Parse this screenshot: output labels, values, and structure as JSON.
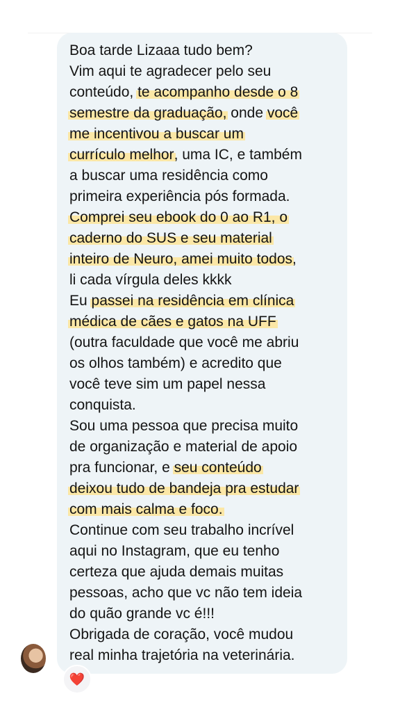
{
  "message": {
    "lines": [
      [
        {
          "t": "Boa tarde Lizaaa tudo bem?",
          "h": false
        }
      ],
      [
        {
          "t": "Vim aqui te agradecer pelo seu",
          "h": false
        }
      ],
      [
        {
          "t": "conteúdo, ",
          "h": false
        },
        {
          "t": "te acompanho desde o 8",
          "h": true
        }
      ],
      [
        {
          "t": "semestre da graduação,",
          "h": true
        },
        {
          "t": " onde ",
          "h": false
        },
        {
          "t": "você",
          "h": true
        }
      ],
      [
        {
          "t": "me incentivou a buscar um",
          "h": true
        }
      ],
      [
        {
          "t": "currículo melhor",
          "h": true
        },
        {
          "t": ", uma IC, e também",
          "h": false
        }
      ],
      [
        {
          "t": "a buscar uma residência como",
          "h": false
        }
      ],
      [
        {
          "t": "primeira experiência pós formada.",
          "h": false
        }
      ],
      [
        {
          "t": "Comprei seu ebook do 0 ao R1, o",
          "h": true
        }
      ],
      [
        {
          "t": "caderno do SUS e seu material",
          "h": true
        }
      ],
      [
        {
          "t": "inteiro de Neuro, amei muito todos",
          "h": true
        },
        {
          "t": ",",
          "h": false
        }
      ],
      [
        {
          "t": "li cada vírgula deles kkkk",
          "h": false
        }
      ],
      [
        {
          "t": "Eu ",
          "h": false
        },
        {
          "t": "passei na residência em clínica",
          "h": true
        }
      ],
      [
        {
          "t": "médica de cães e gatos na UFF",
          "h": true
        }
      ],
      [
        {
          "t": "(outra faculdade que você me abriu",
          "h": false
        }
      ],
      [
        {
          "t": "os olhos também) e acredito que",
          "h": false
        }
      ],
      [
        {
          "t": "você teve sim um papel nessa",
          "h": false
        }
      ],
      [
        {
          "t": "conquista.",
          "h": false
        }
      ],
      [
        {
          "t": "Sou uma pessoa que precisa muito",
          "h": false
        }
      ],
      [
        {
          "t": "de organização e material de apoio",
          "h": false
        }
      ],
      [
        {
          "t": "pra funcionar, e ",
          "h": false
        },
        {
          "t": "seu conteúdo",
          "h": true
        }
      ],
      [
        {
          "t": "deixou tudo de bandeja pra estudar",
          "h": true
        }
      ],
      [
        {
          "t": "com mais calma e foco.",
          "h": true
        }
      ],
      [
        {
          "t": "Continue com seu trabalho incrível",
          "h": false
        }
      ],
      [
        {
          "t": "aqui no Instagram, que eu tenho",
          "h": false
        }
      ],
      [
        {
          "t": "certeza que ajuda demais muitas",
          "h": false
        }
      ],
      [
        {
          "t": "pessoas, acho que vc não tem ideia",
          "h": false
        }
      ],
      [
        {
          "t": "do quão grande vc é!!!",
          "h": false
        }
      ],
      [
        {
          "t": "Obrigada de coração, você mudou",
          "h": false
        }
      ],
      [
        {
          "t": "real minha trajetória na veterinária.",
          "h": false
        }
      ]
    ]
  },
  "reaction": {
    "emoji": "❤️"
  },
  "colors": {
    "bubble": "#eef4f7",
    "highlight": "#fbe7a6",
    "text": "#141414"
  },
  "icons": {
    "avatar": "sender-avatar",
    "reaction": "heart-reaction-icon"
  }
}
